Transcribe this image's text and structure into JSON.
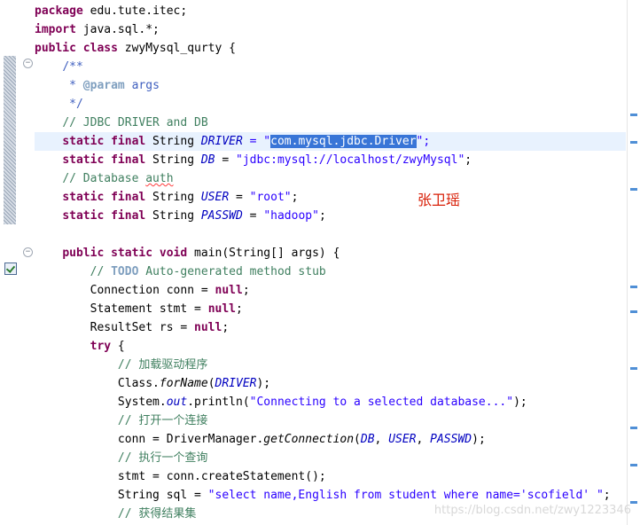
{
  "code": {
    "line_package": {
      "kw": "package",
      "rest": " edu.tute.itec;"
    },
    "line_import": {
      "kw": "import",
      "rest": " java.sql.*;"
    },
    "line_class": {
      "kw": "public class",
      "rest": " zwyMysql_qurty {"
    },
    "line_jd_open": "/**",
    "line_jd_param": {
      "prefix": " * ",
      "tag": "@param",
      "rest": " args"
    },
    "line_jd_close": " */",
    "line_comment_jdbc": "// JDBC DRIVER and DB",
    "line_driver": {
      "kw": "static final",
      "type": " String ",
      "name": "DRIVER",
      "eq": " = \"",
      "selected": "com.mysql.jdbc.Driver",
      "end": "\";"
    },
    "line_db": {
      "kw": "static final",
      "type": " String ",
      "name": "DB",
      "eq": " = ",
      "str": "\"jdbc:mysql://localhost/zwyMysql\"",
      "end": ";"
    },
    "line_comment_auth": {
      "prefix": "// Database ",
      "word": "auth"
    },
    "line_user": {
      "kw": "static final",
      "type": " String ",
      "name": "USER",
      "eq": " = ",
      "str": "\"root\"",
      "end": ";"
    },
    "line_passwd": {
      "kw": "static final",
      "type": " String ",
      "name": "PASSWD",
      "eq": " = ",
      "str": "\"hadoop\"",
      "end": ";"
    },
    "line_main": {
      "kw": "public static void",
      "rest": " main(String[] args) {"
    },
    "line_todo": {
      "prefix": "// ",
      "todo": "TODO",
      "rest": " Auto-generated method stub"
    },
    "line_conn": {
      "text": "Connection conn = ",
      "kw": "null",
      "end": ";"
    },
    "line_stmt": {
      "text": "Statement stmt = ",
      "kw": "null",
      "end": ";"
    },
    "line_rs": {
      "text": "ResultSet rs = ",
      "kw": "null",
      "end": ";"
    },
    "line_try": {
      "kw": "try",
      "rest": " {"
    },
    "line_c_load": "// 加载驱动程序",
    "line_forname": {
      "a": "Class.",
      "m": "forName",
      "b": "(",
      "f": "DRIVER",
      "c": ");"
    },
    "line_println": {
      "a": "System.",
      "f": "out",
      "b": ".println(",
      "str": "\"Connecting to a selected database...\"",
      "c": ");"
    },
    "line_c_open": "// 打开一个连接",
    "line_getconn": {
      "a": "conn = DriverManager.",
      "m": "getConnection",
      "b": "(",
      "f1": "DB",
      "s1": ", ",
      "f2": "USER",
      "s2": ", ",
      "f3": "PASSWD",
      "c": ");"
    },
    "line_c_query": "// 执行一个查询",
    "line_create": "stmt = conn.createStatement();",
    "line_sql": {
      "a": "String sql = ",
      "str": "\"select name,English from student where name='scofield' \"",
      "c": ";"
    },
    "line_c_result": "// 获得结果集"
  },
  "annotation": "张卫瑶",
  "watermark": "https://blog.csdn.net/zwy1223346"
}
